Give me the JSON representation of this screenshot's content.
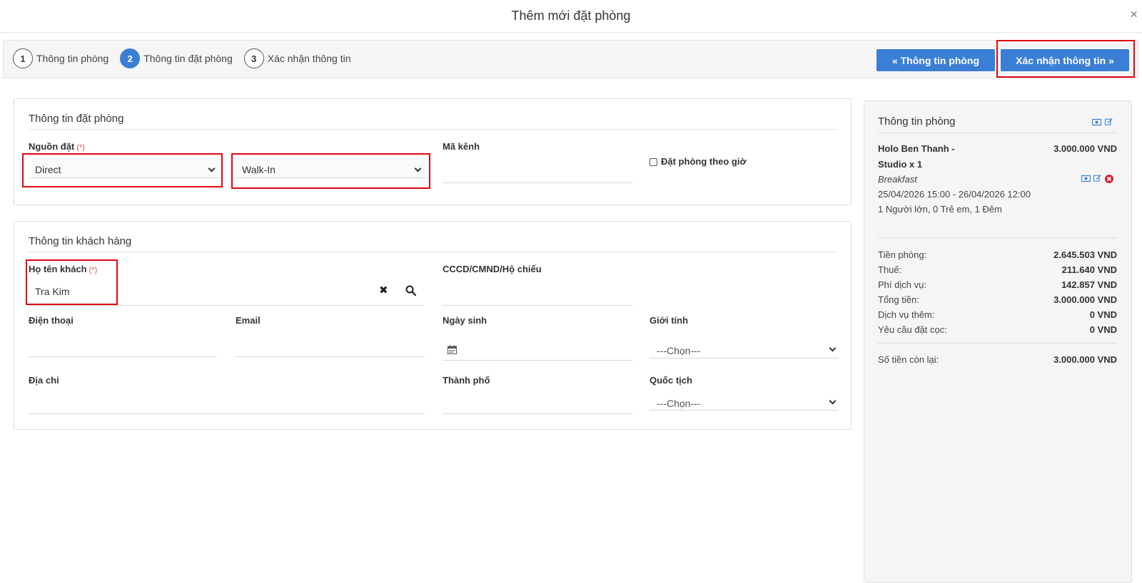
{
  "modal": {
    "title": "Thêm mới đặt phòng",
    "close_symbol": "×"
  },
  "steps": [
    {
      "num": "1",
      "label": "Thông tin phòng"
    },
    {
      "num": "2",
      "label": "Thông tin đặt phòng"
    },
    {
      "num": "3",
      "label": "Xác nhận thông tin"
    }
  ],
  "buttons": {
    "prev": "« Thông tin phòng",
    "next": "Xác nhận thông tin »"
  },
  "booking": {
    "title": "Thông tin đặt phòng",
    "source_label": "Nguồn đặt",
    "required_mark": "(*)",
    "source_value": "Direct",
    "source_sub_value": "Walk-In",
    "channel_label": "Mã kênh",
    "channel_value": "",
    "hourly_label": "Đặt phòng theo giờ"
  },
  "customer": {
    "title": "Thông tin khách hàng",
    "name_label": "Họ tên khách",
    "name_value": "Tra Kim",
    "id_label": "CCCD/CMND/Hộ chiếu",
    "phone_label": "Điện thoại",
    "email_label": "Email",
    "dob_label": "Ngày sinh",
    "gender_label": "Giới tính",
    "gender_value": "---Chọn---",
    "address_label": "Địa chỉ",
    "city_label": "Thành phố",
    "nationality_label": "Quốc tịch",
    "nationality_value": "---Chọn---"
  },
  "room": {
    "title": "Thông tin phòng",
    "name_line1": "Holo Ben Thanh -",
    "name_line2": "Studio x 1",
    "price": "3.000.000 VND",
    "meal": "Breakfast",
    "dates": "25/04/2026 15:00 - 26/04/2026 12:00",
    "guests": "1 Người lớn, 0 Trẻ em, 1 Đêm",
    "summary": [
      {
        "label": "Tiền phòng:",
        "value": "2.645.503 VND"
      },
      {
        "label": "Thuế:",
        "value": "211.640 VND"
      },
      {
        "label": "Phí dịch vụ:",
        "value": "142.857 VND"
      },
      {
        "label": "Tổng tiền:",
        "value": "3.000.000 VND"
      },
      {
        "label": "Dịch vụ thêm:",
        "value": "0 VND"
      },
      {
        "label": "Yêu cầu đặt cọc:",
        "value": "0 VND"
      }
    ],
    "remaining_label": "Số tiền còn lại:",
    "remaining_value": "3.000.000 VND"
  },
  "colors": {
    "accent": "#3a7fd5",
    "highlight": "#e30613",
    "required": "#d9534f"
  }
}
